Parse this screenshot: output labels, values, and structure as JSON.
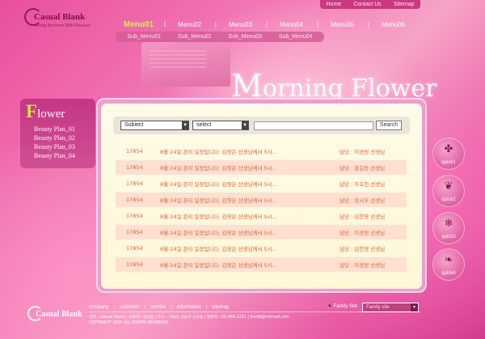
{
  "top_nav": [
    "Home",
    "Contact Us",
    "Sitemap"
  ],
  "logo": {
    "name": "Casual Blank",
    "tagline": "Mixing Business With Pleasure"
  },
  "menu": [
    "Menu01",
    "Menu02",
    "Menu03",
    "Menu04",
    "Menu05",
    "Menu06"
  ],
  "active_menu": "Menu01",
  "submenu": [
    "Sub_Menu01",
    "Sub_Menu02",
    "Sub_Menu03",
    "Sub_Menu04"
  ],
  "hero": {
    "cap": "M",
    "rest": "orning Flower"
  },
  "left_panel": {
    "title_initial": "F",
    "title_rest": "lower",
    "items": [
      "Beauty Plan_01",
      "Beauty Plan_02",
      "Beauty Plan_03",
      "Beauty Plan_04"
    ]
  },
  "search": {
    "field_select": "Subiect",
    "option_select": "select",
    "button_label": "Search"
  },
  "board_rows": [
    {
      "num": "17854",
      "subject": "8월 24일 관리 일정입니다. 김영은 선생님께서 5시...",
      "manager": "담당 : 이경원 선생님"
    },
    {
      "num": "17854",
      "subject": "8월 24일 관리 일정입니다. 김영은 선생님께서 5시...",
      "manager": "담당 : 홍길동 선생님"
    },
    {
      "num": "17854",
      "subject": "8월 24일 관리 일정입니다. 김영은 선생님께서 5시...",
      "manager": "담당 : 주호천 선생님"
    },
    {
      "num": "17854",
      "subject": "8월 24일 관리 일정입니다. 김영은 선생님께서 5시...",
      "manager": "담당 : 장서우 선생님"
    },
    {
      "num": "17854",
      "subject": "8월 24일 관리 일정입니다. 김영은 선생님께서 5시...",
      "manager": "담당 : 김한영 선생님"
    },
    {
      "num": "17854",
      "subject": "8월 24일 관리 일정입니다. 김영은 선생님께서 5시...",
      "manager": "담당 : 이경원 선생님"
    },
    {
      "num": "17854",
      "subject": "8월 24일 관리 일정입니다. 김영은 선생님께서 5시...",
      "manager": "담당 : 김한영 선생님"
    },
    {
      "num": "17854",
      "subject": "8월 24일 관리 일정입니다. 김영은 선생님께서 5시...",
      "manager": "담당 : 이경원 선생님"
    }
  ],
  "quick": [
    {
      "label": "quick1",
      "icon": "clover-icon",
      "glyph": "✤"
    },
    {
      "label": "quick2",
      "icon": "butterfly-icon",
      "glyph": "❦"
    },
    {
      "label": "quick3",
      "icon": "snowflake-icon",
      "glyph": "❄"
    },
    {
      "label": "quick4",
      "icon": "leaf-icon",
      "glyph": "❧"
    }
  ],
  "footer": {
    "logo": "Casual Blank",
    "links": [
      "company",
      "customer",
      "service",
      "information",
      "sitemap"
    ],
    "info_line1": "상호 : Casual Blank | 대표자 : 김길동 | 주소 : 서울시 강남구 신사동 | 연락처 : 02-489-1231 | Sss0k@hotmail.com",
    "info_line2": "COPYRIGHT   2005   ALL RIGHTS RESERVED",
    "family_label": "Family Site",
    "family_select": "Family site"
  }
}
